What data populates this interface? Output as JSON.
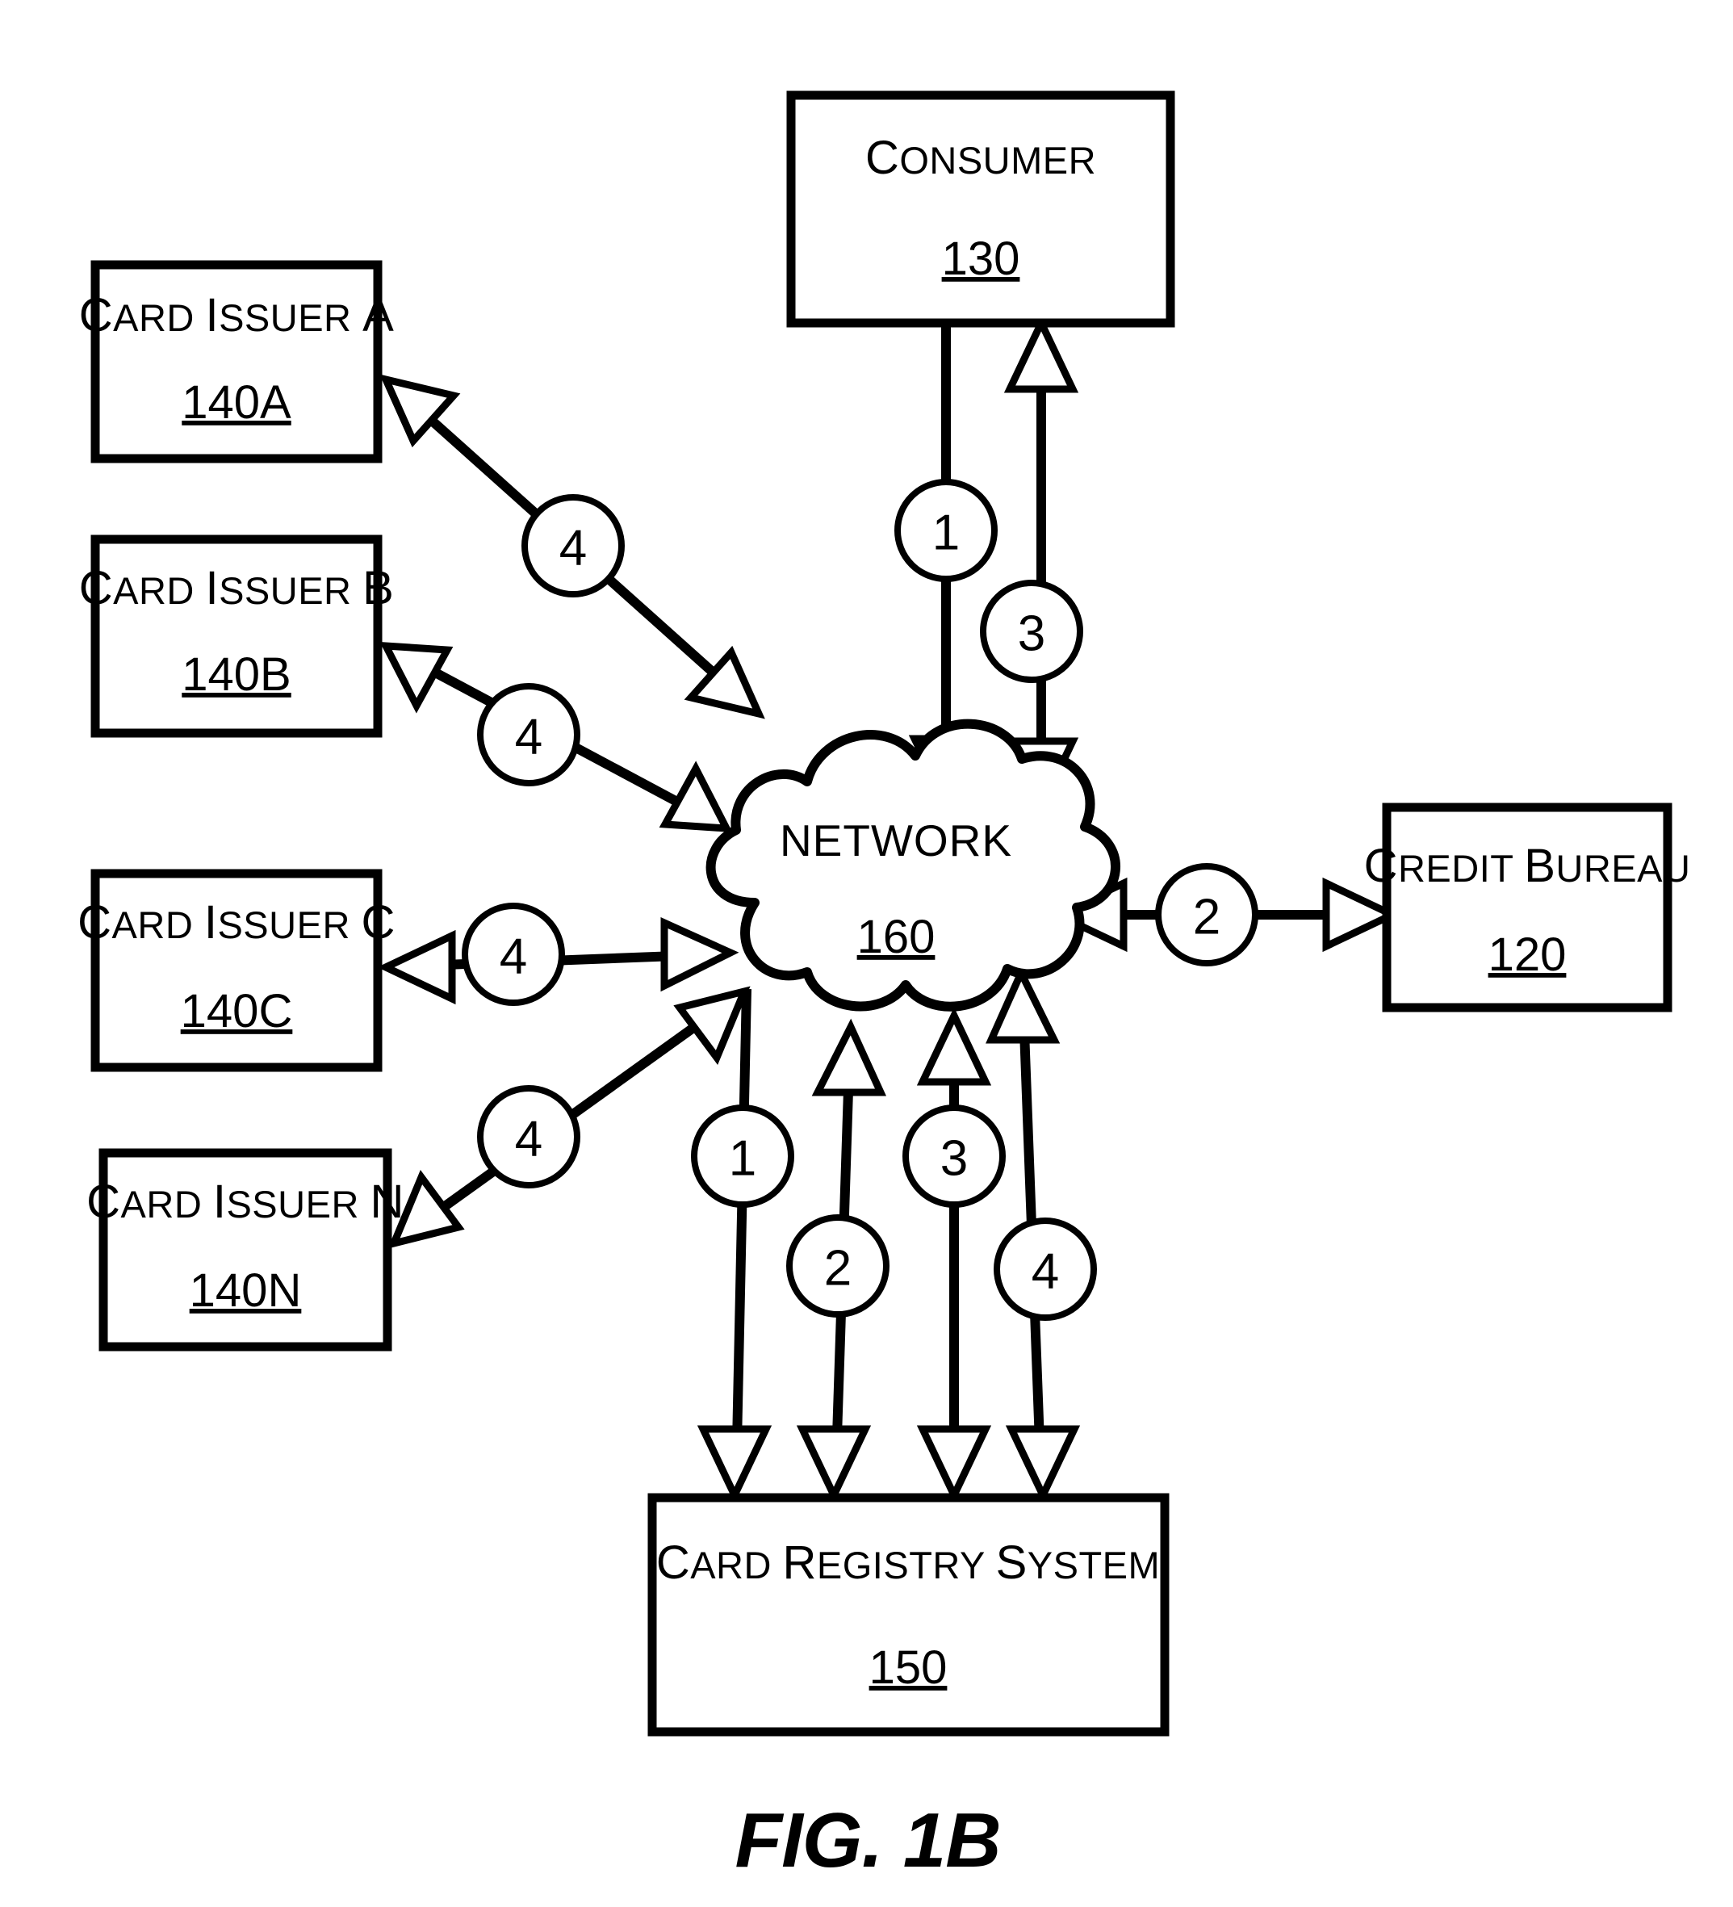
{
  "figure": {
    "caption": "FIG. 1B",
    "type": "patent-block-diagram"
  },
  "nodes": {
    "consumer": {
      "title": "Consumer",
      "ref": "130"
    },
    "credit_bureau": {
      "title": "Credit Bureau",
      "ref": "120"
    },
    "network": {
      "title": "NETWORK",
      "ref": "160"
    },
    "card_registry_system": {
      "title": "Card Registry System",
      "ref": "150"
    },
    "card_issuer_a": {
      "title": "Card Issuer A",
      "ref": "140A"
    },
    "card_issuer_b": {
      "title": "Card Issuer B",
      "ref": "140B"
    },
    "card_issuer_c": {
      "title": "Card Issuer C",
      "ref": "140C"
    },
    "card_issuer_n": {
      "title": "Card Issuer N",
      "ref": "140N"
    }
  },
  "step_markers": {
    "consumer_to_network": "1",
    "network_to_consumer": "3",
    "network_to_credit_bureau": "2",
    "network_to_issuer_a": "4",
    "network_to_issuer_b": "4",
    "network_to_issuer_c": "4",
    "network_to_issuer_n": "4",
    "registry_to_network_1": "1",
    "registry_to_network_2": "2",
    "registry_to_network_3": "3",
    "registry_to_network_4": "4"
  },
  "colors": {
    "stroke": "#000000",
    "fill": "#ffffff",
    "background": "#ffffff"
  }
}
